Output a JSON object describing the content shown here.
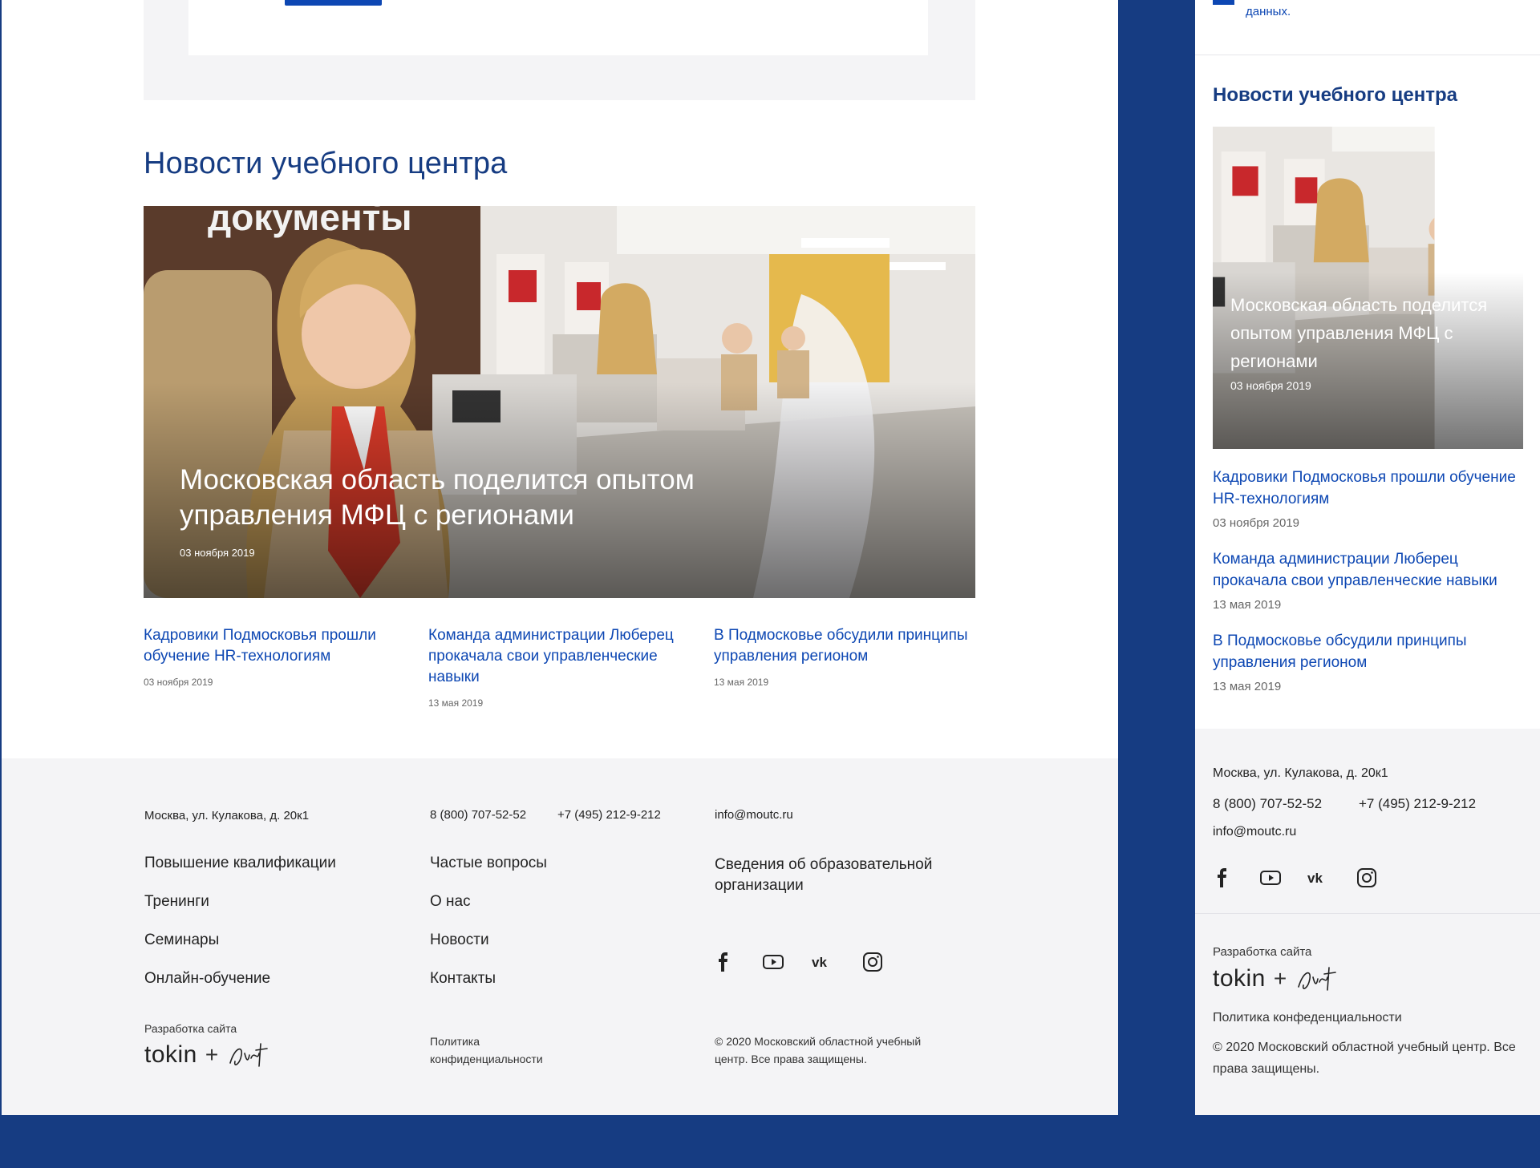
{
  "desktop": {
    "news": {
      "heading": "Новости учебного центра",
      "hero": {
        "title": "Московская область поделится опытом управления МФЦ с регионами",
        "date": "03 ноября 2019"
      },
      "cards": [
        {
          "title": "Кадровики Подмосковья прошли обучение HR-технологиям",
          "date": "03 ноября 2019"
        },
        {
          "title": "Команда администрации Люберец прокачала свои управленческие навыки",
          "date": "13 мая 2019"
        },
        {
          "title": "В Подмосковье обсудили принципы управления регионом",
          "date": "13 мая 2019"
        }
      ]
    },
    "footer": {
      "address": "Москва, ул. Кулакова, д. 20к1",
      "phone1": "8 (800) 707-52-52",
      "phone2": "+7 (495) 212-9-212",
      "email": "info@moutc.ru",
      "col1": [
        "Повышение квалификации",
        "Тренинги",
        "Семинары",
        "Онлайн-обучение"
      ],
      "col2": [
        "Частые вопросы",
        "О нас",
        "Новости",
        "Контакты"
      ],
      "col3": [
        "Сведения об образовательной организации"
      ],
      "dev_label": "Разработка сайта",
      "brand": "tokin",
      "brand_plus": "+",
      "policy": "Политика конфиденциальности",
      "copyright": "© 2020 Московский областной учебный центр. Все права защищены."
    }
  },
  "mobile": {
    "consent_tail": "данных.",
    "news": {
      "heading": "Новости учебного центра",
      "hero": {
        "title": "Московская область поделится опытом управления МФЦ с регионами",
        "date": "03 ноября 2019"
      },
      "cards": [
        {
          "title": "Кадровики Подмосковья прошли обучение HR-технологиям",
          "date": "03 ноября 2019"
        },
        {
          "title": "Команда администрации Люберец прокачала свои управленческие навыки",
          "date": "13 мая 2019"
        },
        {
          "title": "В Подмосковье обсудили принципы управления регионом",
          "date": "13 мая 2019"
        }
      ]
    },
    "footer": {
      "address": "Москва, ул. Кулакова, д. 20к1",
      "phone1": "8 (800) 707-52-52",
      "phone2": "+7 (495) 212-9-212",
      "email": "info@moutc.ru",
      "dev_label": "Разработка сайта",
      "brand": "tokin",
      "brand_plus": "+",
      "policy": "Политика конфеденциальности",
      "copyright": "© 2020 Московский областной учебный центр. Все права защищены."
    }
  },
  "icons": [
    "facebook-icon",
    "youtube-icon",
    "vk-icon",
    "instagram-icon"
  ],
  "colors": {
    "brand_blue": "#163c82",
    "link_blue": "#0d47b3",
    "footer_bg": "#f4f4f6"
  }
}
